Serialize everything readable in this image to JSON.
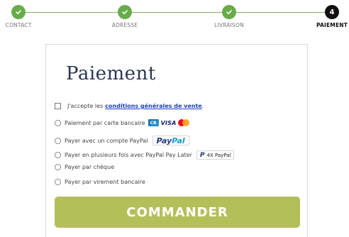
{
  "stepper": {
    "steps": [
      {
        "label": "CONTACT",
        "status": "done"
      },
      {
        "label": "ADRESSE",
        "status": "done"
      },
      {
        "label": "LIVRAISON",
        "status": "done"
      },
      {
        "label": "PAIEMENT",
        "status": "current",
        "number": "4"
      }
    ],
    "colors": {
      "done": "#6aab4a",
      "current": "#111111",
      "line": "#7ab55c"
    }
  },
  "payment": {
    "title": "Paiement",
    "terms": {
      "prefix": "J'accepte les",
      "link": "conditions générales de vente",
      "suffix": "."
    },
    "options": [
      {
        "label": "Paiement par carte bancaire",
        "icons": [
          "cb-icon",
          "visa-icon",
          "mastercard-icon"
        ],
        "cb_text": "CB",
        "visa_text": "VISA"
      },
      {
        "label": "Payer avec un compte PayPal",
        "badge_pay": "Pay",
        "badge_pal": "Pal"
      },
      {
        "label": "Payer en plusieurs fois avec PayPal Pay Later",
        "badge_logo": "P",
        "badge_text": "4X PayPal"
      },
      {
        "label": "Payer par chèque"
      },
      {
        "label": "Payer par virement bancaire"
      }
    ],
    "submit_label": "COMMANDER",
    "colors": {
      "title": "#2b3550",
      "link": "#1e3fbf",
      "button": "#b3c05a"
    }
  }
}
